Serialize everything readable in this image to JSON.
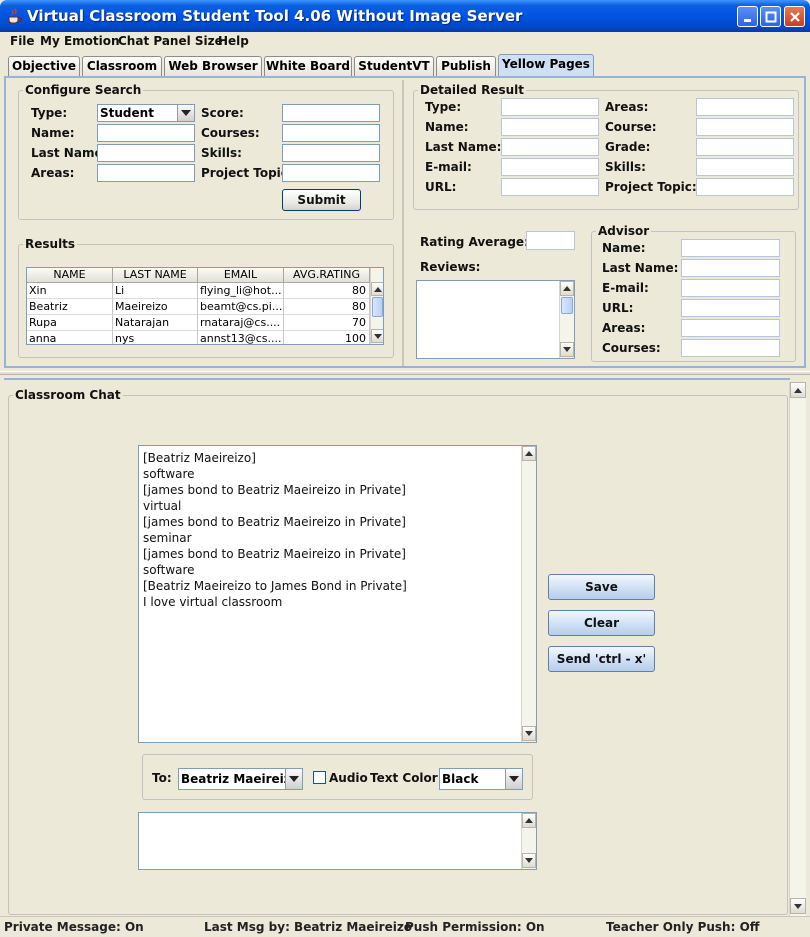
{
  "window": {
    "title": "Virtual Classroom Student Tool 4.06 Without Image Server"
  },
  "menu": [
    "File",
    "My Emotion",
    "Chat Panel Size",
    "Help"
  ],
  "tabs": [
    "Objective",
    "Classroom",
    "Web Browser",
    "White Board",
    "StudentVT",
    "Publish",
    "Yellow Pages"
  ],
  "active_tab": "Yellow Pages",
  "configure_search": {
    "title": "Configure Search",
    "type_label": "Type:",
    "type_value": "Student",
    "name_label": "Name:",
    "lastname_label": "Last Name:",
    "areas_label": "Areas:",
    "score_label": "Score:",
    "courses_label": "Courses:",
    "skills_label": "Skills:",
    "project_topic_label": "Project Topic:",
    "submit_label": "Submit"
  },
  "results": {
    "title": "Results",
    "columns": [
      "NAME",
      "LAST NAME",
      "EMAIL",
      "AVG.RATING"
    ],
    "rows": [
      [
        "Xin",
        "Li",
        "flying_li@hot...",
        "80"
      ],
      [
        "Beatriz",
        "Maeireizo",
        "beamt@cs.pi...",
        "80"
      ],
      [
        "Rupa",
        "Natarajan",
        "rnataraj@cs....",
        "70"
      ],
      [
        "anna",
        "nys",
        "annst13@cs....",
        "100"
      ]
    ]
  },
  "detailed_result": {
    "title": "Detailed Result",
    "type_label": "Type:",
    "name_label": "Name:",
    "lastname_label": "Last Name:",
    "email_label": "E-mail:",
    "url_label": "URL:",
    "areas_label": "Areas:",
    "course_label": "Course:",
    "grade_label": "Grade:",
    "skills_label": "Skills:",
    "project_topic_label": "Project Topic:"
  },
  "rating": {
    "rating_average_label": "Rating Average:",
    "reviews_label": "Reviews:"
  },
  "advisor": {
    "title": "Advisor",
    "name_label": "Name:",
    "lastname_label": "Last Name:",
    "email_label": "E-mail:",
    "url_label": "URL:",
    "areas_label": "Areas:",
    "courses_label": "Courses:"
  },
  "chat": {
    "title": "Classroom Chat",
    "messages": [
      "[Beatriz Maeireizo]",
      "software",
      "[james bond to Beatriz Maeireizo in Private]",
      "virtual",
      "[james bond to Beatriz Maeireizo in Private]",
      "seminar",
      "[james bond to Beatriz Maeireizo in Private]",
      "software",
      "[Beatriz Maeireizo to James Bond in Private]",
      "I love virtual classroom"
    ],
    "save_label": "Save",
    "clear_label": "Clear",
    "send_label": "Send 'ctrl - x'",
    "to_label": "To:",
    "to_value": "Beatriz Maeireizo",
    "audio_label": "Audio",
    "text_color_label": "Text Color:",
    "text_color_value": "Black"
  },
  "status": {
    "private_message": "Private Message: On",
    "last_msg": "Last Msg by: Beatriz Maeireizo",
    "push_permission": "Push Permission: On",
    "teacher_only_push": "Teacher Only Push: Off"
  },
  "colors": {
    "titlebar": "#0054e3",
    "active_tab": "#cfe0f3",
    "field_border": "#7f9db9",
    "window_bg": "#ece9d8"
  }
}
